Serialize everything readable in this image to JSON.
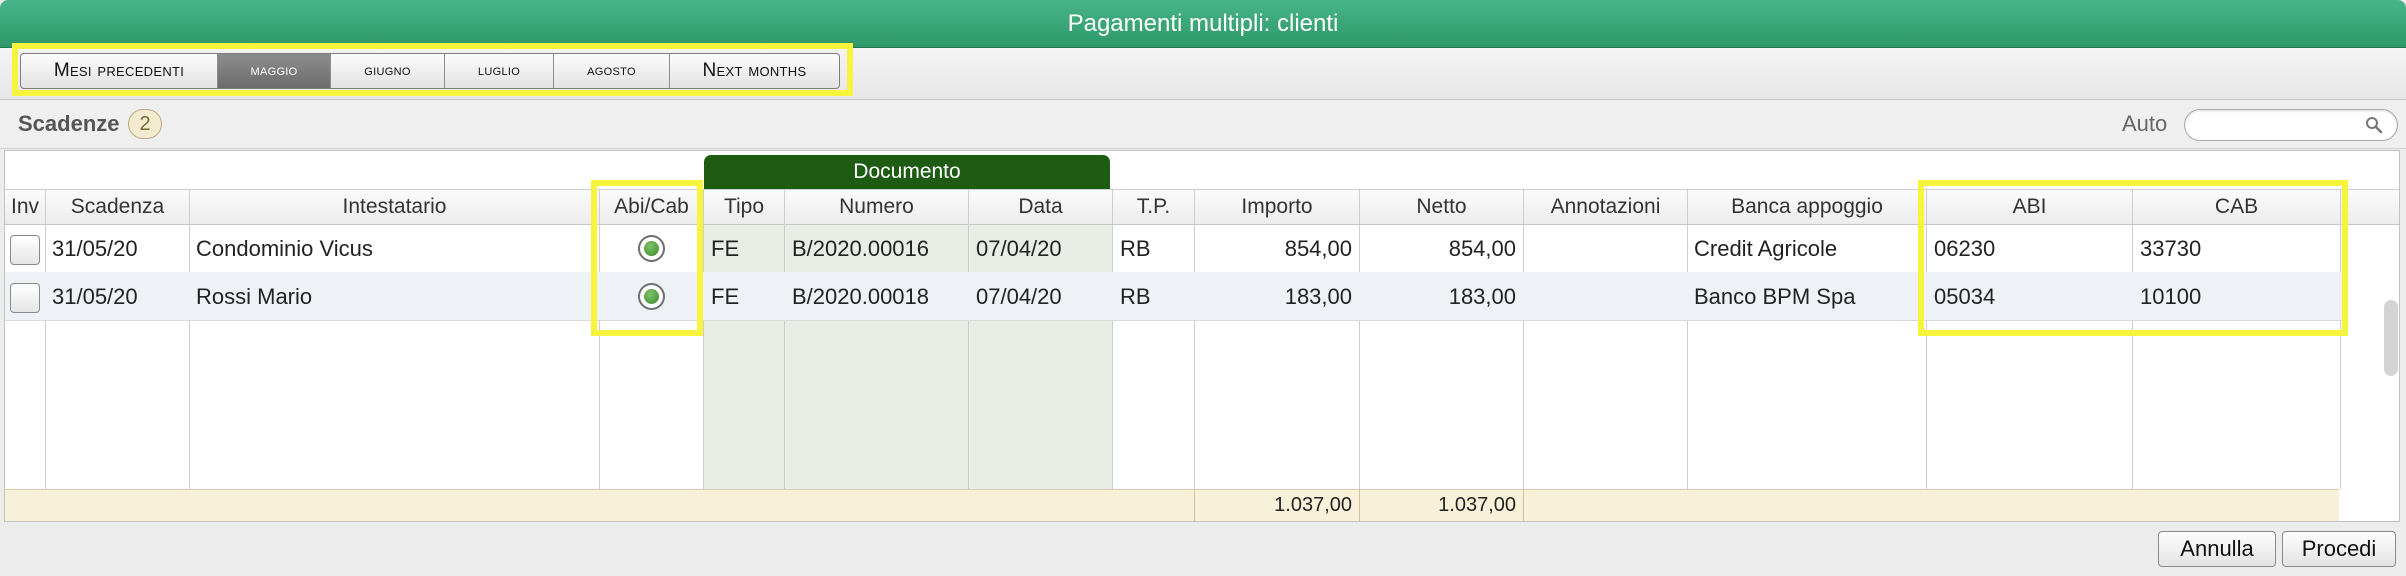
{
  "window": {
    "title": "Pagamenti multipli: clienti"
  },
  "months": [
    {
      "label": "Mesi precedenti",
      "selected": false
    },
    {
      "label": "maggio",
      "selected": true
    },
    {
      "label": "giugno",
      "selected": false
    },
    {
      "label": "luglio",
      "selected": false
    },
    {
      "label": "agosto",
      "selected": false
    },
    {
      "label": "Next months",
      "selected": false
    }
  ],
  "list": {
    "title": "Scadenze",
    "count": "2"
  },
  "auto": {
    "label": "Auto",
    "value": ""
  },
  "table": {
    "group_header": "Documento",
    "columns": {
      "inv": "Inv",
      "scadenza": "Scadenza",
      "intestatario": "Intestatario",
      "abicab": "Abi/Cab",
      "tipo": "Tipo",
      "numero": "Numero",
      "data": "Data",
      "tp": "T.P.",
      "importo": "Importo",
      "netto": "Netto",
      "annotazioni": "Annotazioni",
      "banca": "Banca appoggio",
      "abi": "ABI",
      "cab": "CAB"
    },
    "rows": [
      {
        "scadenza": "31/05/20",
        "intestatario": "Condominio Vicus",
        "abicab_selected": true,
        "tipo": "FE",
        "numero": "B/2020.00016",
        "data": "07/04/20",
        "tp": "RB",
        "importo": "854,00",
        "netto": "854,00",
        "annotazioni": "",
        "banca": "Credit Agricole",
        "abi": "06230",
        "cab": "33730"
      },
      {
        "scadenza": "31/05/20",
        "intestatario": "Rossi Mario",
        "abicab_selected": true,
        "tipo": "FE",
        "numero": "B/2020.00018",
        "data": "07/04/20",
        "tp": "RB",
        "importo": "183,00",
        "netto": "183,00",
        "annotazioni": "",
        "banca": "Banco BPM Spa",
        "abi": "05034",
        "cab": "10100"
      }
    ],
    "totals": {
      "importo": "1.037,00",
      "netto": "1.037,00"
    }
  },
  "footer": {
    "cancel_label": "Annulla",
    "proceed_label": "Procedi"
  },
  "colors": {
    "title_green": "#3aa676",
    "document_band": "#1e5c14",
    "highlight": "#f6f43c",
    "totals_bg": "#f8f1da"
  }
}
